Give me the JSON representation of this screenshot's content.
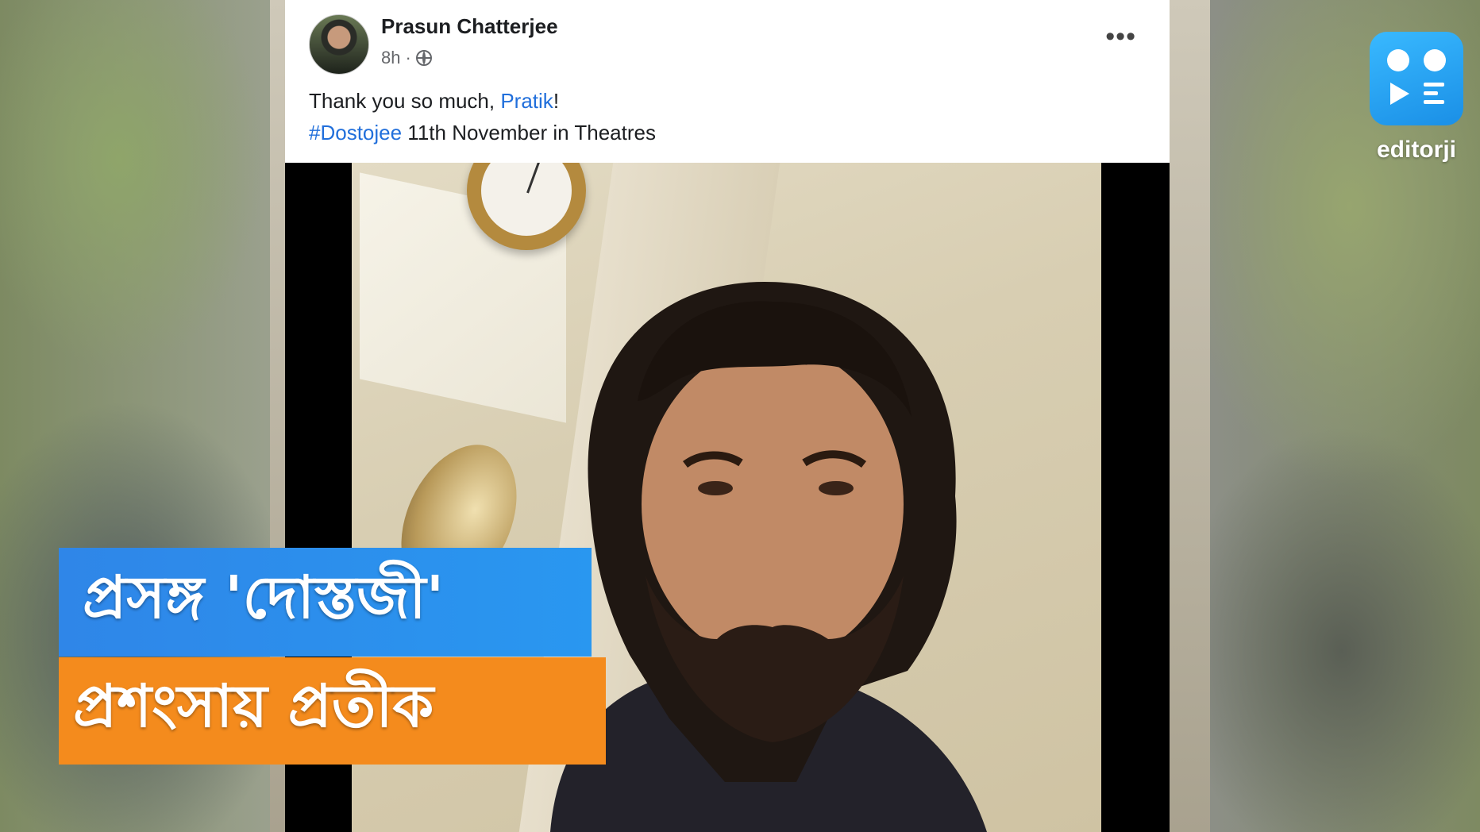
{
  "post": {
    "author": "Prasun Chatterjee",
    "time": "8h",
    "separator": "·",
    "more_label": "•••",
    "line1_prefix": "Thank you so much, ",
    "line1_mention": "Pratik",
    "line1_suffix": "!",
    "hashtag": "#Dostojee",
    "line2_rest": " 11th November in Theatres",
    "icons": [
      "globe-icon",
      "more-options-icon"
    ]
  },
  "banner": {
    "line1": "প্রসঙ্গ 'দোস্তজী'",
    "line1_color": "#2f86e8",
    "line2": "প্রশংসায় প্রতীক",
    "line2_color": "#f48b1d"
  },
  "brand": {
    "name": "editorji",
    "color": "#1a8fe6"
  },
  "colors": {
    "link": "#216fdb",
    "text": "#1c1e21",
    "meta": "#65676b"
  }
}
